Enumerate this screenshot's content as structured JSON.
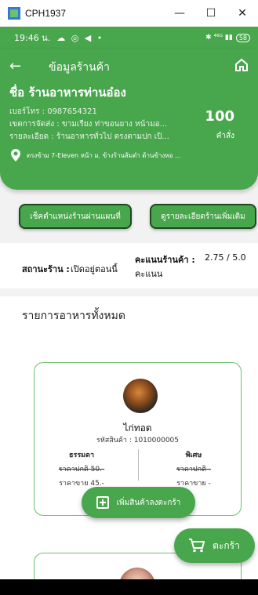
{
  "window": {
    "title": "CPH1937",
    "minimize": "—",
    "maximize": "☐",
    "close": "✕"
  },
  "status_bar": {
    "time": "19:46 น.",
    "icons_left": "☁ ◎ ◀ •",
    "icons_right": "✱ ⁴⁶ᴳ ▮▮",
    "battery": "58"
  },
  "header": {
    "title": "ข้อมูลร้านค้า",
    "shop_label": "ชื่อ",
    "shop_name": "ร้านอาหารท่านอ๋อง",
    "phone": "เบอร์โทร : 0987654321",
    "delivery": "เขตการจัดส่ง : ขามเรียง ท่าขอนยาง หน้ามอ...",
    "detail": "รายละเอียด : ร้านอาหารทั่วไป ตรงตามปก เปิ...",
    "address": "ตรงข้าม 7-Eleven หน้า ม. ข้างร้านส้มตำ ด้านข้างหอ ...",
    "order_count": "100",
    "order_count_label": "คำสั่ง"
  },
  "buttons": {
    "map": "เช็คตำแหน่งร้านผ่านแผนที่",
    "detail": "ดูรายละเอียดร้านเพิ่มเติม"
  },
  "store_status": {
    "label": "สถานะร้าน :",
    "value": "เปิดอยู่ตอนนี้",
    "score_label": "คะแนนร้านค้า :",
    "score_value": "2.75 / 5.0",
    "score_unit": "คะแนน"
  },
  "list": {
    "title": "รายการอาหารทั้งหมด",
    "items": [
      {
        "name": "ไก่ทอด",
        "code": "รหัสสินค้า : 1010000005",
        "normal_title": "ธรรมดา",
        "normal_original": "ราคาปกติ 50.-",
        "normal_sale": "ราคาขาย 45.-",
        "special_title": "พิเศษ",
        "special_original": "ราคาปกติ -",
        "special_sale": "ราคาขาย -",
        "add_label": "เพิ่มสินค้าลงตะกร้า"
      }
    ]
  },
  "cart": {
    "label": "ตะกร้า"
  },
  "nav": {
    "menu": "☰",
    "home": "▢",
    "back": "◁"
  },
  "colors": {
    "primary": "#48a64c",
    "dark_border": "#1e4a20"
  }
}
